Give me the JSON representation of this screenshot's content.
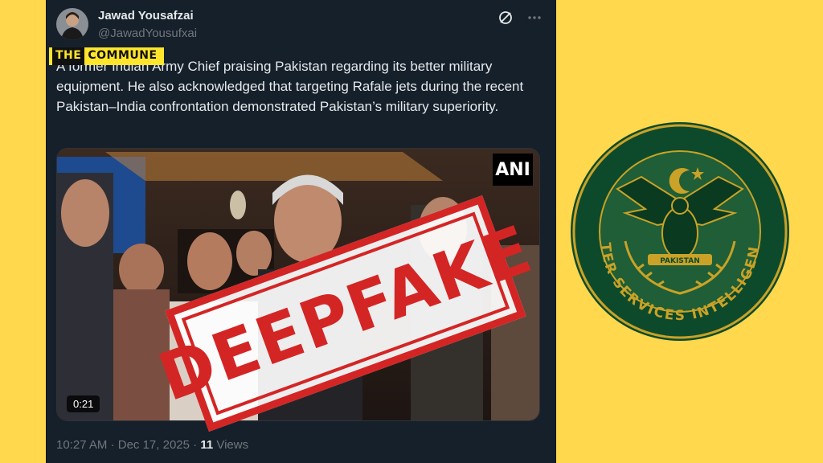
{
  "tweet": {
    "author_name": "Jawad Yousafzai",
    "author_handle": "@JawadYousufxai",
    "body": "A former Indian Army Chief praising Pakistan regarding its better military equipment. He also acknowledged that targeting Rafale jets during the recent Pakistan–India confrontation demonstrated Pakistan’s military superiority.",
    "time": "10:27 AM",
    "date": "Dec 17, 2025",
    "views_count": "11",
    "views_label": "Views"
  },
  "media": {
    "source_logo": "ANI",
    "duration": "0:21",
    "stamp_text": "DEEPFAKE"
  },
  "badge": {
    "part1": "THE",
    "part2": "COMMUNE"
  },
  "emblem": {
    "ring_text": "INTER SERVICES INTELLIGENCE",
    "banner_text": "PAKISTAN",
    "colors": {
      "outer": "#0D4A2B",
      "inner": "#1F5E36",
      "gold": "#C9A227"
    }
  },
  "icons": {
    "grok": "grok-icon",
    "more": "more-icon"
  },
  "colors": {
    "background": "#FFD84D",
    "tweet_bg": "#15202B",
    "stamp": "#D42525"
  }
}
